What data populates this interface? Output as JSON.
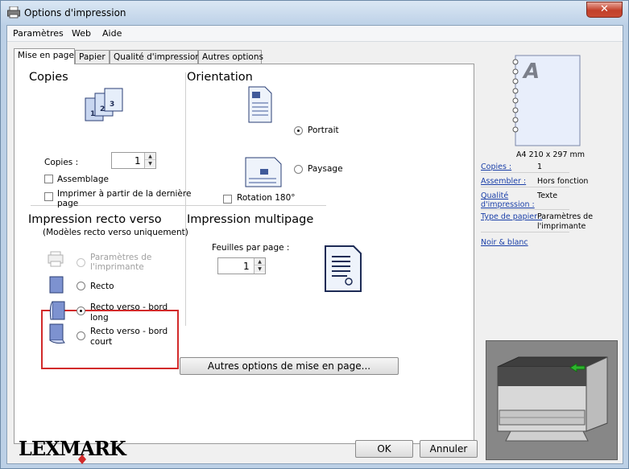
{
  "window": {
    "title": "Options d'impression",
    "close_label": "✕"
  },
  "menu": [
    "Paramètres",
    "Web",
    "Aide"
  ],
  "tabs": [
    "Mise en page",
    "Papier",
    "Qualité d'impression",
    "Autres options"
  ],
  "copies": {
    "title": "Copies",
    "label": "Copies :",
    "value": "1",
    "collate": "Assemblage",
    "reverse_line1": "Imprimer à partir de la dernière",
    "reverse_line2": "page"
  },
  "orientation": {
    "title": "Orientation",
    "portrait": "Portrait",
    "landscape": "Paysage",
    "rotate": "Rotation 180°"
  },
  "duplex": {
    "title": "Impression recto verso",
    "subtitle": "(Modèles recto verso uniquement)",
    "printer_settings_line1": "Paramètres de",
    "printer_settings_line2": "l'imprimante",
    "simplex": "Recto",
    "long_edge_line1": "Recto verso - bord",
    "long_edge_line2": "long",
    "short_edge_line1": "Recto verso - bord",
    "short_edge_line2": "court"
  },
  "multipage": {
    "title": "Impression multipage",
    "label": "Feuilles par page :",
    "value": "1"
  },
  "more_layout_button": "Autres options de mise en page...",
  "preview": {
    "letter": "A",
    "size": "A4 210 x 297 mm"
  },
  "summary": [
    {
      "key": "Copies :",
      "value": "1"
    },
    {
      "key": "Assembler :",
      "value": "Hors fonction"
    },
    {
      "key": "Qualité d'impression :",
      "key1": "Qualité",
      "key2": "d'impression :",
      "value": "Texte"
    },
    {
      "key": "Type de papier :",
      "value1": "Paramètres de",
      "value2": "l'imprimante"
    }
  ],
  "summary_link": "Noir & blanc",
  "brand": "LEXMARK",
  "buttons": {
    "ok": "OK",
    "cancel": "Annuler"
  },
  "colors": {
    "accent_red": "#d22a2a",
    "link": "#1a3fa8",
    "arrow_green": "#2db52d"
  }
}
